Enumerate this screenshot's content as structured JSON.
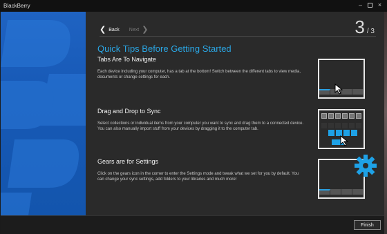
{
  "window": {
    "app_title": "BlackBerry",
    "minimize": "–",
    "close": "×"
  },
  "nav": {
    "back_label": "Back",
    "next_label": "Next",
    "back_chevron": "❮",
    "next_chevron": "❯",
    "step_current": "3",
    "step_total": "/ 3"
  },
  "headline": "Quick Tips Before Getting Started",
  "tips": [
    {
      "title": "Tabs Are To Navigate",
      "body": "Each device including your computer, has a tab at the bottom! Switch between the different tabs to view media, documents or change settings for each."
    },
    {
      "title": "Drag and Drop to Sync",
      "body": "Select collections or individual items from your computer you want to sync and drag them to a connected device. You can also manually import stuff from your devices by dragging it to the computer tab."
    },
    {
      "title": "Gears are for Settings",
      "body": "Click on the gears icon in the corner to enter the Settings mode and tweak what we set for you by default. You can change your sync settings, add folders to your libraries and much more!"
    }
  ],
  "footer": {
    "finish_label": "Finish"
  },
  "colors": {
    "accent": "#2aa6e4",
    "panel_blue": "#1759b6",
    "background": "#2a2a2a"
  }
}
